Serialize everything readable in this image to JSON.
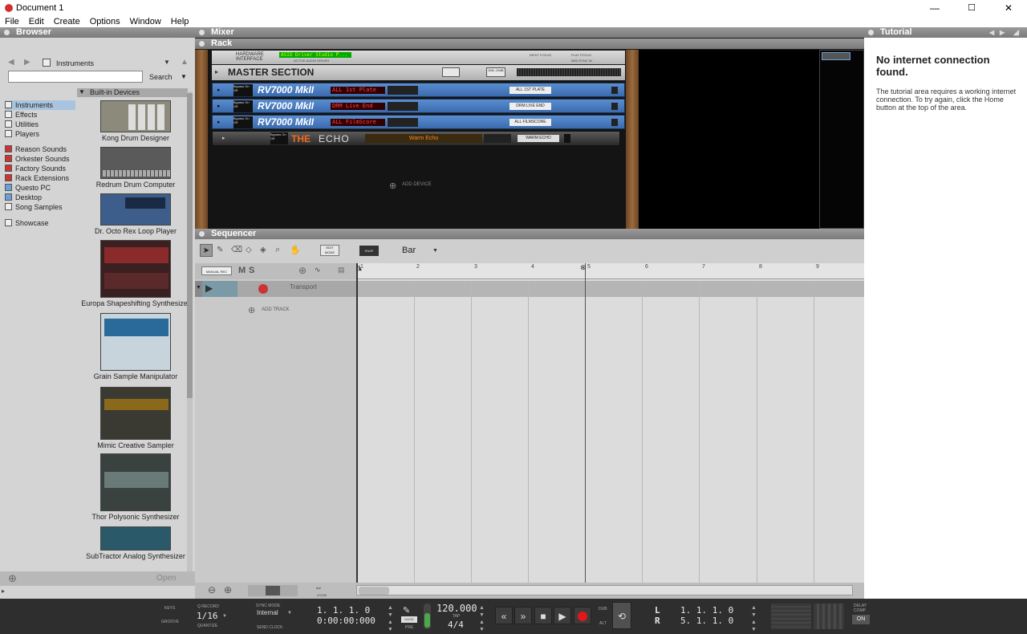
{
  "window": {
    "title": "Document 1",
    "minimize": "—",
    "maximize": "☐",
    "close": "✕"
  },
  "menu": [
    "File",
    "Edit",
    "Create",
    "Options",
    "Window",
    "Help"
  ],
  "browser": {
    "header": "Browser",
    "location": "Instruments",
    "search_button": "Search",
    "section": "Built-in Devices",
    "locations": [
      "Instruments",
      "Effects",
      "Utilities",
      "Players",
      "Reason Sounds",
      "Orkester Sounds",
      "Factory Sounds",
      "Rack Extensions",
      "Questo PC",
      "Desktop",
      "Song Samples",
      "Showcase"
    ],
    "devices": [
      "Kong Drum Designer",
      "Redrum Drum Computer",
      "Dr. Octo Rex Loop Player",
      "Europa Shapeshifting Synthesizer",
      "Grain Sample Manipulator",
      "Mimic Creative Sampler",
      "Thor Polysonic Synthesizer",
      "SubTractor Analog Synthesizer"
    ],
    "open_button": "Open"
  },
  "mixer": {
    "header": "Mixer"
  },
  "rack": {
    "header": "Rack",
    "hardware_interface": "HARDWARE INTERFACE",
    "audio_driver": "ASIO Driver Studio P...",
    "active_audio_driver": "ACTIVE AUDIO DRIVER",
    "input_focus": "INPUT FOCUS",
    "play_focus": "PLAY FOCUS",
    "midi_sync_in": "MIDI SYNC IN",
    "master_section": "MASTER SECTION",
    "dim_label": "DIM -20dB",
    "devices": [
      {
        "name": "RV7000 MkII",
        "patch": "ALL 1st Plate",
        "label": "ALL 1ST PLATE"
      },
      {
        "name": "RV7000 MkII",
        "patch": "DRM Live End",
        "label": "DRM LIVE END"
      },
      {
        "name": "RV7000 MkII",
        "patch": "ALL FilmScore",
        "label": "ALL FILMSCORE"
      }
    ],
    "echo": {
      "name_a": "THE",
      "name_b": "ECHO",
      "patch": "Warm Echo",
      "label": "WARM ECHO"
    },
    "bypass": "Bypass On Off",
    "add_device": "ADD DEVICE"
  },
  "sequencer": {
    "header": "Sequencer",
    "edit_mode": "EDIT MODE",
    "snap": "SNAP",
    "snap_value": "Bar",
    "manual_rec": "MANUAL REC",
    "mute": "M",
    "solo": "S",
    "transport_track": "Transport",
    "add_track": "ADD TRACK",
    "ruler": [
      "1",
      "2",
      "3",
      "4",
      "5",
      "6",
      "7",
      "8",
      "9"
    ],
    "zoom": "ZOOM"
  },
  "tutorial": {
    "header": "Tutorial",
    "title": "No internet connection found.",
    "body": "The tutorial area requires a working internet connection. To try again, click the Home button at the top of the area."
  },
  "transport": {
    "keys": "KEYS",
    "groove": "GROOVE",
    "q_record": "Q RECORD",
    "quantize_value": "1/16",
    "quantize": "QUANTIZE",
    "sync_mode": "SYNC MODE",
    "sync_value": "Internal",
    "send_clock": "SEND CLOCK",
    "position": "1.  1.  1.    0",
    "time": "0:00:00:000",
    "click": "CLICK",
    "pre": "PRE",
    "tempo": "120.000",
    "tap": "TAP",
    "signature": "4/4",
    "dub": "DUB",
    "alt": "ALT",
    "loop_l_label": "L",
    "loop_r_label": "R",
    "loop_l": "1.  1.  1.    0",
    "loop_r": "5.  1.  1.    0",
    "delay_comp": "DELAY COMP",
    "on": "ON"
  }
}
